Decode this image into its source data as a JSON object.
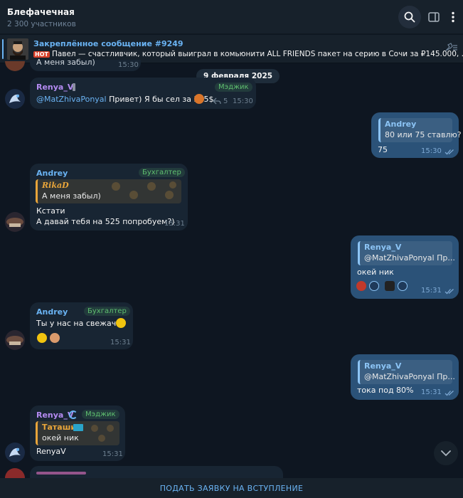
{
  "header": {
    "title": "Блефачечная",
    "members": "2 300 участников"
  },
  "pinned": {
    "title": "Закреплённое сообщение #9249",
    "badge": "HOT",
    "text": "Павел — счастливчик, который выиграл в комьюнити ALL FRIENDS пакет на серию в Сочи за ₽145.000, ..."
  },
  "date_separator": "9 февраля 2025",
  "messages": {
    "m0": {
      "text": "А меня забыл)",
      "time": "15:30"
    },
    "m1": {
      "author": "Renya_V",
      "author_color": "#b48bf2",
      "role": "Мэджик",
      "mention": "@MatZhivaPonyal",
      "text": " Привет) Я бы сел за 525$",
      "replies": "5",
      "time": "15:30"
    },
    "m2": {
      "reply_author": "Andrey",
      "reply_text": "80 или 75 ставлю?",
      "text": "75",
      "time": "15:30"
    },
    "m3": {
      "author": "Andrey",
      "author_color": "#6ab3f3",
      "role": "Бухгалтер",
      "reply_author": "RikaD",
      "reply_text": "А меня забыл)",
      "line1": "Кстати",
      "line2": "А давай тебя на 525 попробуем?)",
      "time": "15:31"
    },
    "m4": {
      "reply_author": "Renya_V",
      "reply_text": "@MatZhivaPonyal Пр...",
      "text": "окей ник",
      "time": "15:31"
    },
    "m5": {
      "author": "Andrey",
      "author_color": "#6ab3f3",
      "role": "Бухгалтер",
      "text": "Ты у нас на свежачка",
      "time": "15:31"
    },
    "m6": {
      "reply_author": "Renya_V",
      "reply_text": "@MatZhivaPonyal Пр...",
      "text": "тока под 80%",
      "time": "15:31"
    },
    "m7": {
      "author": "Renya_V",
      "author_color": "#b48bf2",
      "role": "Мэджик",
      "reply_author": "Таташи",
      "reply_text": "окей ник",
      "text": "RenyaV",
      "time": "15:31"
    }
  },
  "footer": {
    "join_label": "ПОДАТЬ ЗАЯВКУ НА ВСТУПЛЕНИЕ"
  },
  "colors": {
    "accent": "#6ab3f3",
    "incoming_bubble": "#182533",
    "outgoing_bubble": "#2b5278",
    "background": "#0e1621"
  },
  "icons": [
    "search-icon",
    "sidebar-panel-icon",
    "more-vertical-icon",
    "unpin-icon",
    "reply-icon",
    "double-check-icon",
    "chevron-down-icon"
  ]
}
